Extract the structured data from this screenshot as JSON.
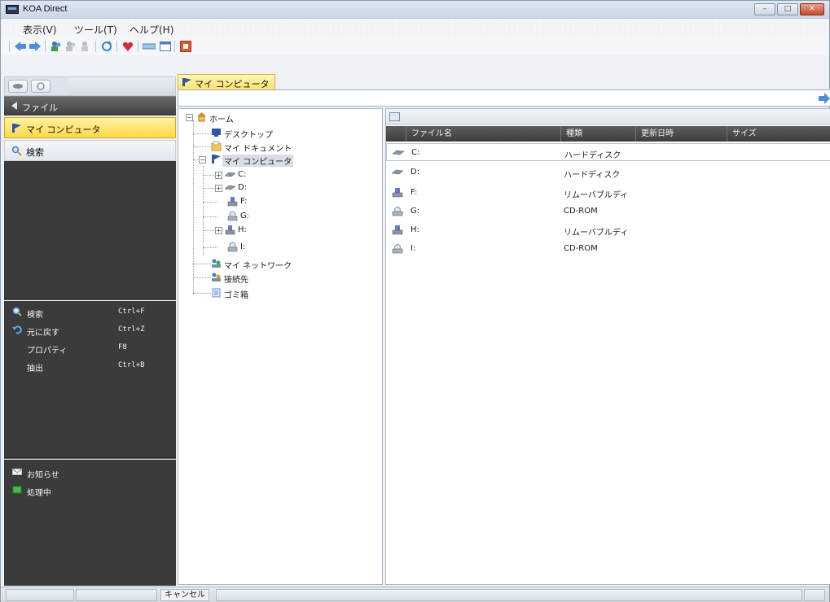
{
  "window": {
    "title": "KOA Direct"
  },
  "menu": [
    "表示(V)",
    "ツール(T)",
    "ヘルプ(H)"
  ],
  "toolbar_icons": [
    "back-arrow-icon",
    "forward-arrow-icon",
    "people-icon",
    "people-disabled-icon",
    "user-disabled-icon",
    "refresh-icon",
    "heart-icon",
    "bar-icon",
    "window-icon",
    "stop-icon"
  ],
  "left_panel": {
    "section_title": "ファイル",
    "nav": [
      {
        "label": "マイ コンピュータ",
        "selected": true
      },
      {
        "label": "検索",
        "selected": false
      }
    ],
    "tasks": [
      {
        "label": "検索",
        "shortcut": "Ctrl+F",
        "icon": "search-icon"
      },
      {
        "label": "元に戻す",
        "shortcut": "Ctrl+Z",
        "icon": "undo-icon"
      },
      {
        "label": "プロパティ",
        "shortcut": "F8",
        "icon": ""
      },
      {
        "label": "抽出",
        "shortcut": "Ctrl+B",
        "icon": ""
      }
    ],
    "status_items": [
      {
        "label": "お知らせ",
        "icon": "mail-icon"
      },
      {
        "label": "処理中",
        "icon": "green-square-icon"
      }
    ]
  },
  "location_tab": "マイ コンピュータ",
  "tree": {
    "home": "ホーム",
    "desktop": "デスクトップ",
    "my_documents": "マイ ドキュメント",
    "my_computer": "マイ コンピュータ",
    "drives": [
      "C:",
      "D:",
      "F:",
      "G:",
      "H:",
      "I:"
    ],
    "my_network": "マイ ネットワーク",
    "connections": "接続先",
    "trash": "ゴミ箱"
  },
  "list": {
    "columns": [
      "ファイル名",
      "種類",
      "更新日時",
      "サイズ"
    ],
    "rows": [
      {
        "name": "C:",
        "type": "ハードディスク",
        "icon": "hard-disk-icon"
      },
      {
        "name": "D:",
        "type": "ハードディスク",
        "icon": "hard-disk-icon"
      },
      {
        "name": "F:",
        "type": "リムーバブルディ",
        "icon": "removable-drive-icon"
      },
      {
        "name": "G:",
        "type": "CD-ROM",
        "icon": "cd-rom-icon"
      },
      {
        "name": "H:",
        "type": "リムーバブルディ",
        "icon": "removable-drive-icon"
      },
      {
        "name": "I:",
        "type": "CD-ROM",
        "icon": "cd-rom-icon"
      }
    ]
  },
  "statusbar": {
    "cancel_label": "キャンセル"
  },
  "colors": {
    "selection_yellow": "#ffd84a",
    "dark_panel": "#3b3b3b",
    "column_header": "#4a4a4a"
  }
}
